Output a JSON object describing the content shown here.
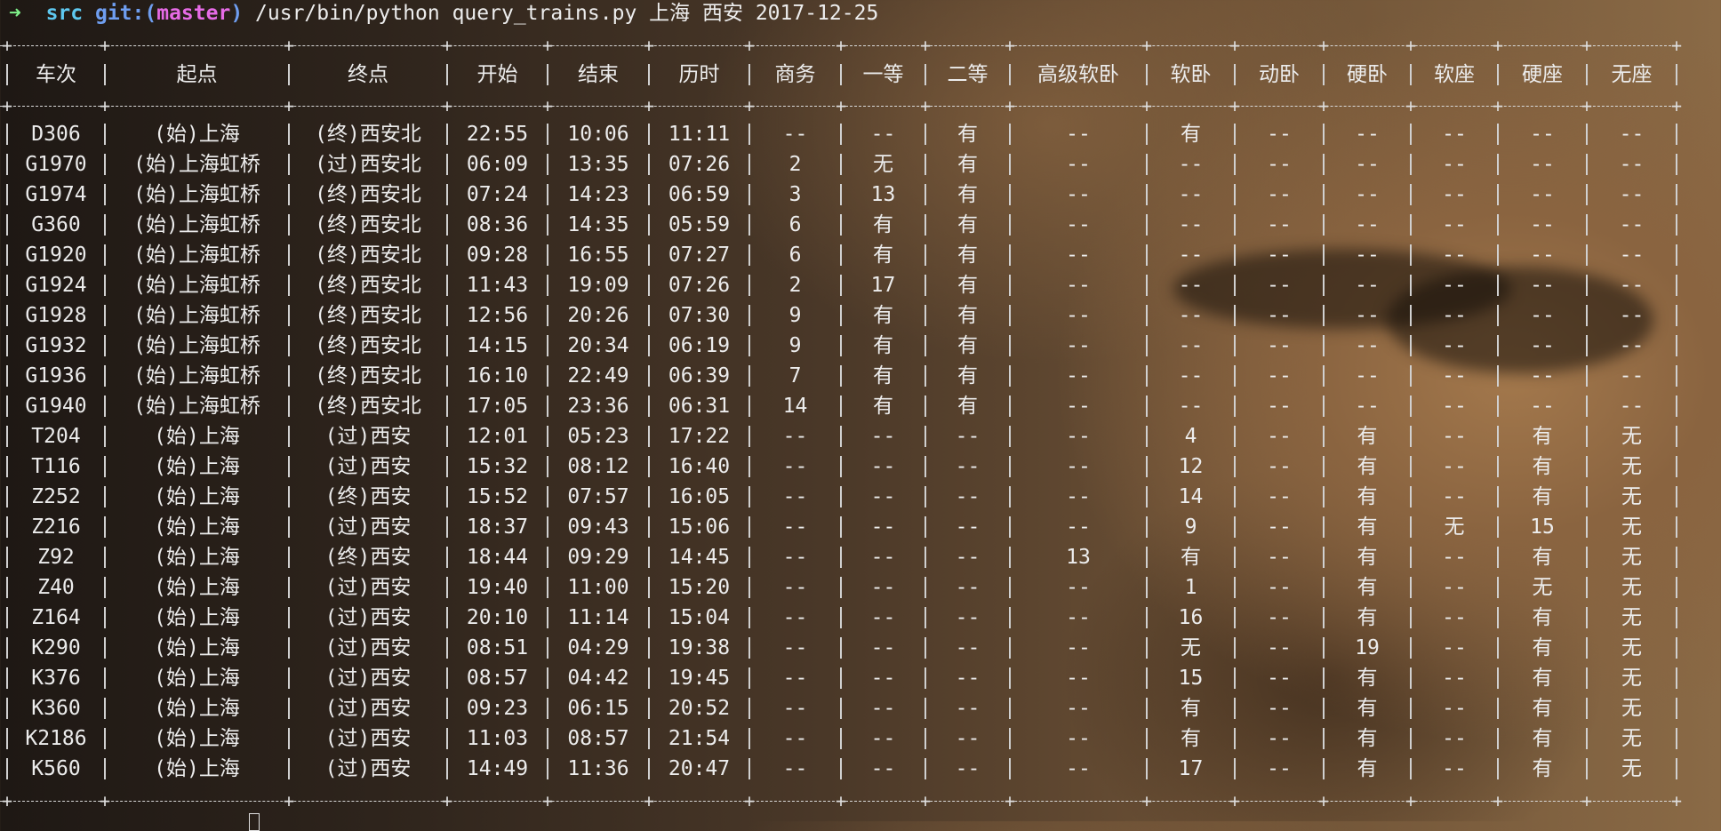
{
  "terminal": {
    "prompt": {
      "arrow": "➜",
      "dir": "src",
      "git_label": "git:(",
      "branch": "master",
      "git_close": ")",
      "command": "/usr/bin/python query_trains.py 上海 西安 2017-12-25"
    }
  },
  "table": {
    "headers": [
      "车次",
      "起点",
      "终点",
      "开始",
      "结束",
      "历时",
      "商务",
      "一等",
      "二等",
      "高级软卧",
      "软卧",
      "动卧",
      "硬卧",
      "软座",
      "硬座",
      "无座"
    ],
    "rows": [
      [
        "D306",
        "(始)上海",
        "(终)西安北",
        "22:55",
        "10:06",
        "11:11",
        "--",
        "--",
        "有",
        "--",
        "有",
        "--",
        "--",
        "--",
        "--",
        "--"
      ],
      [
        "G1970",
        "(始)上海虹桥",
        "(过)西安北",
        "06:09",
        "13:35",
        "07:26",
        "2",
        "无",
        "有",
        "--",
        "--",
        "--",
        "--",
        "--",
        "--",
        "--"
      ],
      [
        "G1974",
        "(始)上海虹桥",
        "(终)西安北",
        "07:24",
        "14:23",
        "06:59",
        "3",
        "13",
        "有",
        "--",
        "--",
        "--",
        "--",
        "--",
        "--",
        "--"
      ],
      [
        "G360",
        "(始)上海虹桥",
        "(终)西安北",
        "08:36",
        "14:35",
        "05:59",
        "6",
        "有",
        "有",
        "--",
        "--",
        "--",
        "--",
        "--",
        "--",
        "--"
      ],
      [
        "G1920",
        "(始)上海虹桥",
        "(终)西安北",
        "09:28",
        "16:55",
        "07:27",
        "6",
        "有",
        "有",
        "--",
        "--",
        "--",
        "--",
        "--",
        "--",
        "--"
      ],
      [
        "G1924",
        "(始)上海虹桥",
        "(终)西安北",
        "11:43",
        "19:09",
        "07:26",
        "2",
        "17",
        "有",
        "--",
        "--",
        "--",
        "--",
        "--",
        "--",
        "--"
      ],
      [
        "G1928",
        "(始)上海虹桥",
        "(终)西安北",
        "12:56",
        "20:26",
        "07:30",
        "9",
        "有",
        "有",
        "--",
        "--",
        "--",
        "--",
        "--",
        "--",
        "--"
      ],
      [
        "G1932",
        "(始)上海虹桥",
        "(终)西安北",
        "14:15",
        "20:34",
        "06:19",
        "9",
        "有",
        "有",
        "--",
        "--",
        "--",
        "--",
        "--",
        "--",
        "--"
      ],
      [
        "G1936",
        "(始)上海虹桥",
        "(终)西安北",
        "16:10",
        "22:49",
        "06:39",
        "7",
        "有",
        "有",
        "--",
        "--",
        "--",
        "--",
        "--",
        "--",
        "--"
      ],
      [
        "G1940",
        "(始)上海虹桥",
        "(终)西安北",
        "17:05",
        "23:36",
        "06:31",
        "14",
        "有",
        "有",
        "--",
        "--",
        "--",
        "--",
        "--",
        "--",
        "--"
      ],
      [
        "T204",
        "(始)上海",
        "(过)西安",
        "12:01",
        "05:23",
        "17:22",
        "--",
        "--",
        "--",
        "--",
        "4",
        "--",
        "有",
        "--",
        "有",
        "无"
      ],
      [
        "T116",
        "(始)上海",
        "(过)西安",
        "15:32",
        "08:12",
        "16:40",
        "--",
        "--",
        "--",
        "--",
        "12",
        "--",
        "有",
        "--",
        "有",
        "无"
      ],
      [
        "Z252",
        "(始)上海",
        "(终)西安",
        "15:52",
        "07:57",
        "16:05",
        "--",
        "--",
        "--",
        "--",
        "14",
        "--",
        "有",
        "--",
        "有",
        "无"
      ],
      [
        "Z216",
        "(始)上海",
        "(过)西安",
        "18:37",
        "09:43",
        "15:06",
        "--",
        "--",
        "--",
        "--",
        "9",
        "--",
        "有",
        "无",
        "15",
        "无"
      ],
      [
        "Z92",
        "(始)上海",
        "(终)西安",
        "18:44",
        "09:29",
        "14:45",
        "--",
        "--",
        "--",
        "13",
        "有",
        "--",
        "有",
        "--",
        "有",
        "无"
      ],
      [
        "Z40",
        "(始)上海",
        "(过)西安",
        "19:40",
        "11:00",
        "15:20",
        "--",
        "--",
        "--",
        "--",
        "1",
        "--",
        "有",
        "--",
        "无",
        "无"
      ],
      [
        "Z164",
        "(始)上海",
        "(过)西安",
        "20:10",
        "11:14",
        "15:04",
        "--",
        "--",
        "--",
        "--",
        "16",
        "--",
        "有",
        "--",
        "有",
        "无"
      ],
      [
        "K290",
        "(始)上海",
        "(过)西安",
        "08:51",
        "04:29",
        "19:38",
        "--",
        "--",
        "--",
        "--",
        "无",
        "--",
        "19",
        "--",
        "有",
        "无"
      ],
      [
        "K376",
        "(始)上海",
        "(过)西安",
        "08:57",
        "04:42",
        "19:45",
        "--",
        "--",
        "--",
        "--",
        "15",
        "--",
        "有",
        "--",
        "有",
        "无"
      ],
      [
        "K360",
        "(始)上海",
        "(过)西安",
        "09:23",
        "06:15",
        "20:52",
        "--",
        "--",
        "--",
        "--",
        "有",
        "--",
        "有",
        "--",
        "有",
        "无"
      ],
      [
        "K2186",
        "(始)上海",
        "(过)西安",
        "11:03",
        "08:57",
        "21:54",
        "--",
        "--",
        "--",
        "--",
        "有",
        "--",
        "有",
        "--",
        "有",
        "无"
      ],
      [
        "K560",
        "(始)上海",
        "(过)西安",
        "14:49",
        "11:36",
        "20:47",
        "--",
        "--",
        "--",
        "--",
        "17",
        "--",
        "有",
        "--",
        "有",
        "无"
      ]
    ]
  },
  "colors": {
    "prompt_arrow": "#7ff28a",
    "dir": "#5ec8f0",
    "git": "#6f9ef0",
    "branch": "#e66be6",
    "text": "#ececec"
  }
}
